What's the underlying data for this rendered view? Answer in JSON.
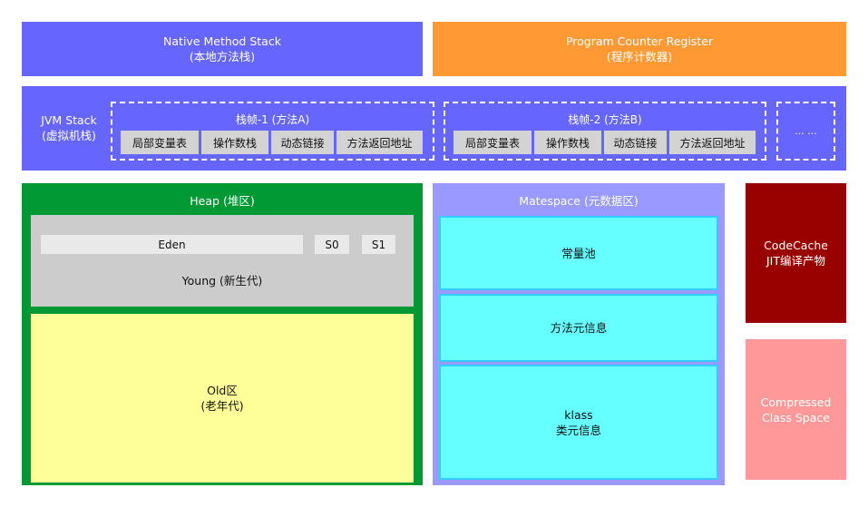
{
  "native_method_stack": {
    "title": "Native Method Stack",
    "subtitle": "(本地方法栈)"
  },
  "program_counter": {
    "title": "Program Counter Register",
    "subtitle": "(程序计数器)"
  },
  "jvm_stack": {
    "title": "JVM Stack",
    "subtitle": "(虚拟机栈)",
    "frames": [
      {
        "title": "栈帧-1 (方法A)",
        "cells": [
          "局部变量表",
          "操作数栈",
          "动态链接",
          "方法返回地址"
        ]
      },
      {
        "title": "栈帧-2 (方法B)",
        "cells": [
          "局部变量表",
          "操作数栈",
          "动态链接",
          "方法返回地址"
        ]
      }
    ],
    "more": "... ..."
  },
  "heap": {
    "title": "Heap (堆区)",
    "young": {
      "eden": "Eden",
      "s0": "S0",
      "s1": "S1",
      "label": "Young (新生代)"
    },
    "old": {
      "title": "Old区",
      "subtitle": "(老年代)"
    }
  },
  "metaspace": {
    "title": "Matespace (元数据区)",
    "items": [
      {
        "line1": "常量池",
        "line2": ""
      },
      {
        "line1": "方法元信息",
        "line2": ""
      },
      {
        "line1": "klass",
        "line2": "类元信息"
      }
    ]
  },
  "code_cache": {
    "title": "CodeCache",
    "subtitle": "JIT编译产物"
  },
  "compressed_class_space": {
    "title": "Compressed",
    "subtitle": "Class Space"
  },
  "colors": {
    "purple": "#6666ff",
    "orange": "#ff9933",
    "heap_green": "#009933",
    "young_gray": "#cccccc",
    "old_yellow": "#ffff99",
    "metaspace_lavender": "#9999ff",
    "metaspace_cyan": "#66ffff",
    "code_cache_red": "#990000",
    "compressed_pink": "#ff9999"
  }
}
